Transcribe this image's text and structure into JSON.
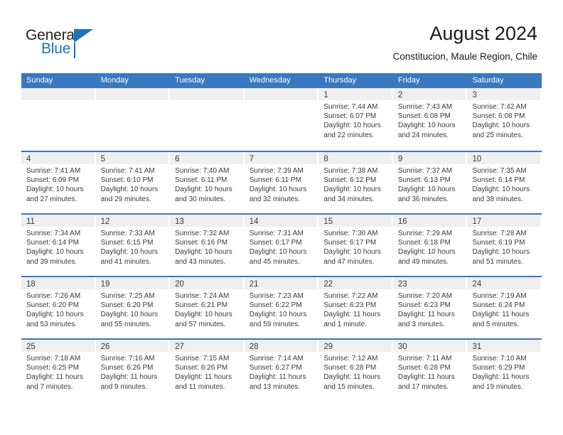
{
  "brand": {
    "word_one": "General",
    "word_two": "Blue",
    "accent_color": "#1b75bb"
  },
  "header": {
    "title": "August 2024",
    "subtitle": "Constitucion, Maule Region, Chile"
  },
  "theme": {
    "header_blue": "#3a78bf",
    "daynum_band": "#efefef",
    "text": "#3a3a3a"
  },
  "weekdays": [
    "Sunday",
    "Monday",
    "Tuesday",
    "Wednesday",
    "Thursday",
    "Friday",
    "Saturday"
  ],
  "weeks": [
    [
      {
        "day": "",
        "lines": []
      },
      {
        "day": "",
        "lines": []
      },
      {
        "day": "",
        "lines": []
      },
      {
        "day": "",
        "lines": []
      },
      {
        "day": "1",
        "lines": [
          "Sunrise: 7:44 AM",
          "Sunset: 6:07 PM",
          "Daylight: 10 hours",
          "and 22 minutes."
        ]
      },
      {
        "day": "2",
        "lines": [
          "Sunrise: 7:43 AM",
          "Sunset: 6:08 PM",
          "Daylight: 10 hours",
          "and 24 minutes."
        ]
      },
      {
        "day": "3",
        "lines": [
          "Sunrise: 7:42 AM",
          "Sunset: 6:08 PM",
          "Daylight: 10 hours",
          "and 25 minutes."
        ]
      }
    ],
    [
      {
        "day": "4",
        "lines": [
          "Sunrise: 7:41 AM",
          "Sunset: 6:09 PM",
          "Daylight: 10 hours",
          "and 27 minutes."
        ]
      },
      {
        "day": "5",
        "lines": [
          "Sunrise: 7:41 AM",
          "Sunset: 6:10 PM",
          "Daylight: 10 hours",
          "and 29 minutes."
        ]
      },
      {
        "day": "6",
        "lines": [
          "Sunrise: 7:40 AM",
          "Sunset: 6:11 PM",
          "Daylight: 10 hours",
          "and 30 minutes."
        ]
      },
      {
        "day": "7",
        "lines": [
          "Sunrise: 7:39 AM",
          "Sunset: 6:11 PM",
          "Daylight: 10 hours",
          "and 32 minutes."
        ]
      },
      {
        "day": "8",
        "lines": [
          "Sunrise: 7:38 AM",
          "Sunset: 6:12 PM",
          "Daylight: 10 hours",
          "and 34 minutes."
        ]
      },
      {
        "day": "9",
        "lines": [
          "Sunrise: 7:37 AM",
          "Sunset: 6:13 PM",
          "Daylight: 10 hours",
          "and 36 minutes."
        ]
      },
      {
        "day": "10",
        "lines": [
          "Sunrise: 7:35 AM",
          "Sunset: 6:14 PM",
          "Daylight: 10 hours",
          "and 38 minutes."
        ]
      }
    ],
    [
      {
        "day": "11",
        "lines": [
          "Sunrise: 7:34 AM",
          "Sunset: 6:14 PM",
          "Daylight: 10 hours",
          "and 39 minutes."
        ]
      },
      {
        "day": "12",
        "lines": [
          "Sunrise: 7:33 AM",
          "Sunset: 6:15 PM",
          "Daylight: 10 hours",
          "and 41 minutes."
        ]
      },
      {
        "day": "13",
        "lines": [
          "Sunrise: 7:32 AM",
          "Sunset: 6:16 PM",
          "Daylight: 10 hours",
          "and 43 minutes."
        ]
      },
      {
        "day": "14",
        "lines": [
          "Sunrise: 7:31 AM",
          "Sunset: 6:17 PM",
          "Daylight: 10 hours",
          "and 45 minutes."
        ]
      },
      {
        "day": "15",
        "lines": [
          "Sunrise: 7:30 AM",
          "Sunset: 6:17 PM",
          "Daylight: 10 hours",
          "and 47 minutes."
        ]
      },
      {
        "day": "16",
        "lines": [
          "Sunrise: 7:29 AM",
          "Sunset: 6:18 PM",
          "Daylight: 10 hours",
          "and 49 minutes."
        ]
      },
      {
        "day": "17",
        "lines": [
          "Sunrise: 7:28 AM",
          "Sunset: 6:19 PM",
          "Daylight: 10 hours",
          "and 51 minutes."
        ]
      }
    ],
    [
      {
        "day": "18",
        "lines": [
          "Sunrise: 7:26 AM",
          "Sunset: 6:20 PM",
          "Daylight: 10 hours",
          "and 53 minutes."
        ]
      },
      {
        "day": "19",
        "lines": [
          "Sunrise: 7:25 AM",
          "Sunset: 6:20 PM",
          "Daylight: 10 hours",
          "and 55 minutes."
        ]
      },
      {
        "day": "20",
        "lines": [
          "Sunrise: 7:24 AM",
          "Sunset: 6:21 PM",
          "Daylight: 10 hours",
          "and 57 minutes."
        ]
      },
      {
        "day": "21",
        "lines": [
          "Sunrise: 7:23 AM",
          "Sunset: 6:22 PM",
          "Daylight: 10 hours",
          "and 59 minutes."
        ]
      },
      {
        "day": "22",
        "lines": [
          "Sunrise: 7:22 AM",
          "Sunset: 6:23 PM",
          "Daylight: 11 hours",
          "and 1 minute."
        ]
      },
      {
        "day": "23",
        "lines": [
          "Sunrise: 7:20 AM",
          "Sunset: 6:23 PM",
          "Daylight: 11 hours",
          "and 3 minutes."
        ]
      },
      {
        "day": "24",
        "lines": [
          "Sunrise: 7:19 AM",
          "Sunset: 6:24 PM",
          "Daylight: 11 hours",
          "and 5 minutes."
        ]
      }
    ],
    [
      {
        "day": "25",
        "lines": [
          "Sunrise: 7:18 AM",
          "Sunset: 6:25 PM",
          "Daylight: 11 hours",
          "and 7 minutes."
        ]
      },
      {
        "day": "26",
        "lines": [
          "Sunrise: 7:16 AM",
          "Sunset: 6:26 PM",
          "Daylight: 11 hours",
          "and 9 minutes."
        ]
      },
      {
        "day": "27",
        "lines": [
          "Sunrise: 7:15 AM",
          "Sunset: 6:26 PM",
          "Daylight: 11 hours",
          "and 11 minutes."
        ]
      },
      {
        "day": "28",
        "lines": [
          "Sunrise: 7:14 AM",
          "Sunset: 6:27 PM",
          "Daylight: 11 hours",
          "and 13 minutes."
        ]
      },
      {
        "day": "29",
        "lines": [
          "Sunrise: 7:12 AM",
          "Sunset: 6:28 PM",
          "Daylight: 11 hours",
          "and 15 minutes."
        ]
      },
      {
        "day": "30",
        "lines": [
          "Sunrise: 7:11 AM",
          "Sunset: 6:28 PM",
          "Daylight: 11 hours",
          "and 17 minutes."
        ]
      },
      {
        "day": "31",
        "lines": [
          "Sunrise: 7:10 AM",
          "Sunset: 6:29 PM",
          "Daylight: 11 hours",
          "and 19 minutes."
        ]
      }
    ]
  ]
}
